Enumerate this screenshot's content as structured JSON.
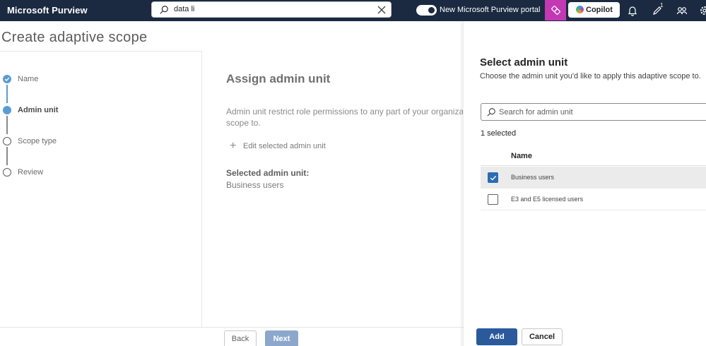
{
  "topbar": {
    "brand": "Microsoft Purview",
    "search_value": "data li",
    "portal_toggle_label": "New Microsoft Purview portal",
    "portal_toggle_on": true,
    "copilot_label": "Copilot",
    "notification_badge": "1",
    "colors": {
      "bar": "#1b2a41",
      "accent": "#c239b3"
    },
    "icons": [
      "search-icon",
      "close-icon",
      "purview-app-icon",
      "copilot-icon",
      "bell-icon",
      "feedback-icon",
      "connections-icon",
      "settings-icon"
    ]
  },
  "page": {
    "title": "Create adaptive scope"
  },
  "wizard": {
    "steps": [
      {
        "label": "Name",
        "state": "done"
      },
      {
        "label": "Admin unit",
        "state": "current"
      },
      {
        "label": "Scope type",
        "state": "pending"
      },
      {
        "label": "Review",
        "state": "pending"
      }
    ]
  },
  "main": {
    "title": "Assign admin unit",
    "description_line1": "Admin unit restrict role permissions to any part of your organizati",
    "description_line2": "scope to.",
    "edit_link": "Edit selected admin unit",
    "selected_label": "Selected admin unit:",
    "selected_value": "Business users"
  },
  "footer": {
    "back_label": "Back",
    "next_label": "Next"
  },
  "panel": {
    "title": "Select admin unit",
    "subtitle": "Choose the admin unit you'd like to apply this adaptive scope to.",
    "search_placeholder": "Search for admin unit",
    "selected_count": "1 selected",
    "column_name": "Name",
    "rows": [
      {
        "name": "Business users",
        "checked": true
      },
      {
        "name": "E3 and E5 licensed users",
        "checked": false
      }
    ],
    "add_label": "Add",
    "cancel_label": "Cancel",
    "colors": {
      "primary": "#2a5a9c",
      "checkbox": "#2b6cb3"
    }
  }
}
